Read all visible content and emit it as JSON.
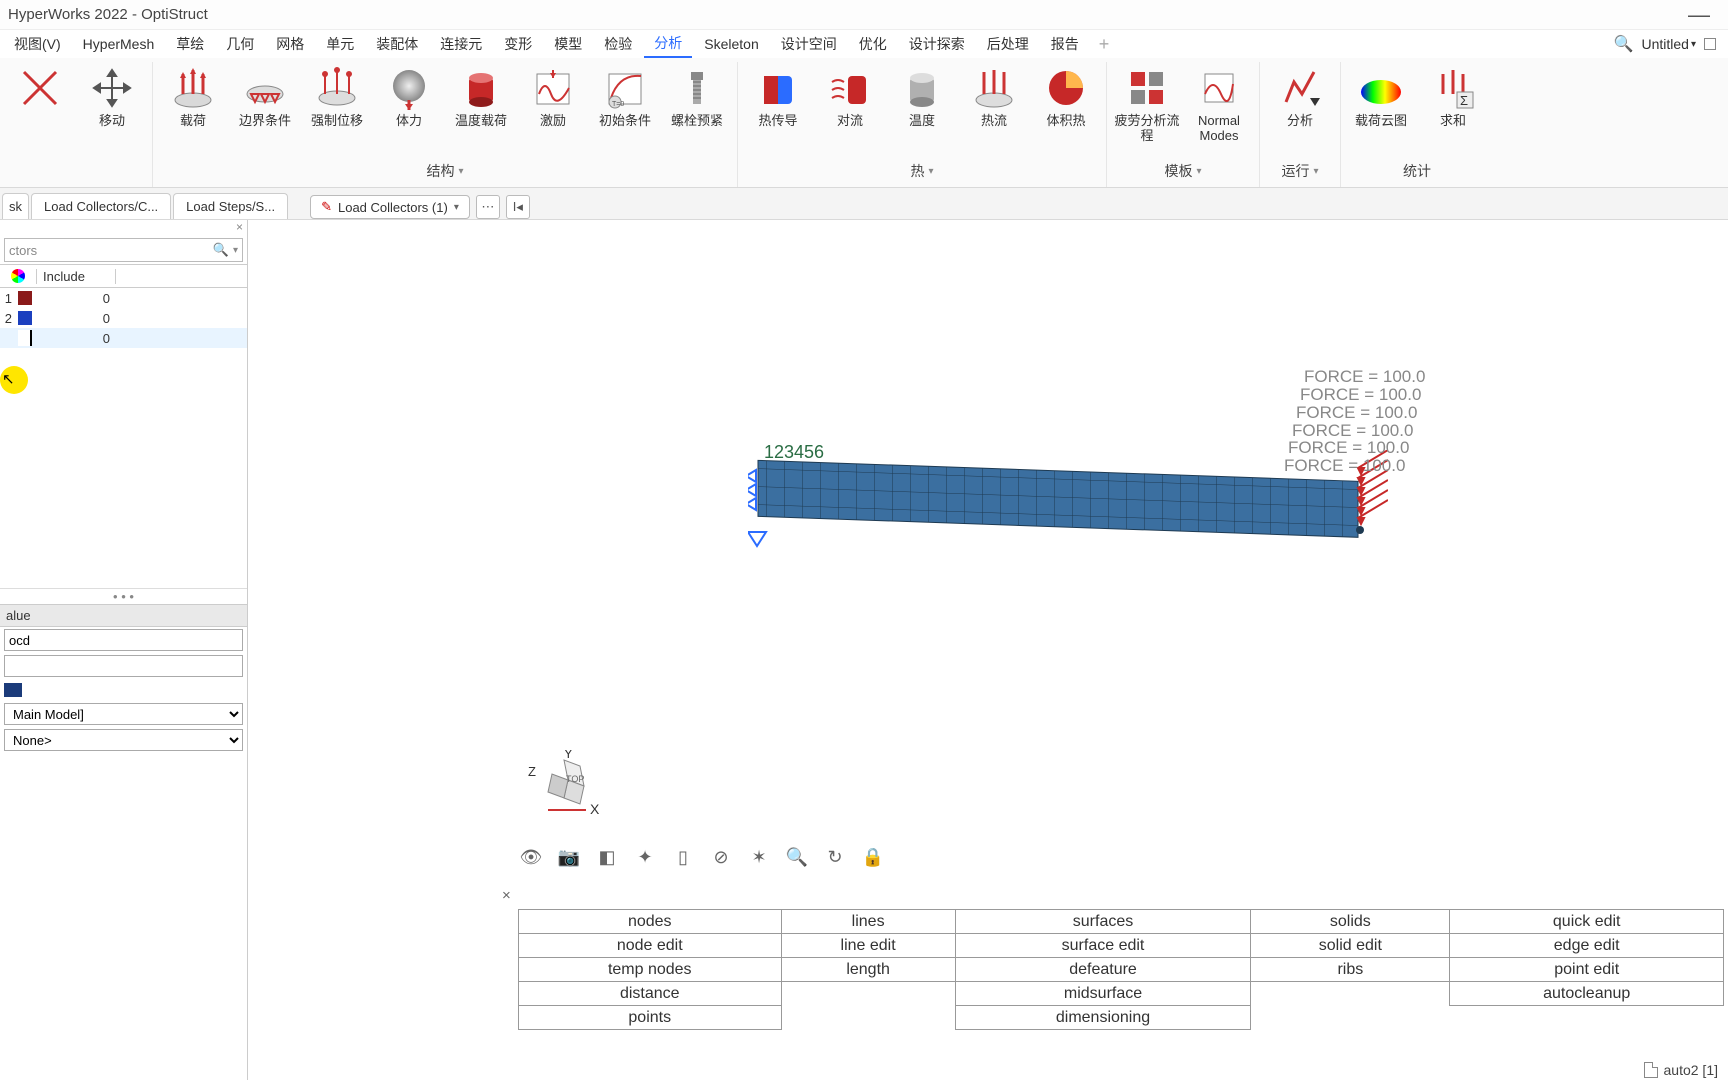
{
  "title": "HyperWorks 2022 - OptiStruct",
  "doc_name": "Untitled",
  "menus": [
    "视图(V)",
    "HyperMesh",
    "草绘",
    "几何",
    "网格",
    "单元",
    "装配体",
    "连接元",
    "变形",
    "模型",
    "检验",
    "分析",
    "Skeleton",
    "设计空间",
    "优化",
    "设计探索",
    "后处理",
    "报告"
  ],
  "active_menu": 11,
  "ribbon": {
    "g_move": {
      "label": "",
      "items": [
        {
          "l": "移动"
        }
      ]
    },
    "g_struct": {
      "label": "结构",
      "items": [
        {
          "l": "载荷"
        },
        {
          "l": "边界条件"
        },
        {
          "l": "强制位移"
        },
        {
          "l": "体力"
        },
        {
          "l": "温度载荷"
        },
        {
          "l": "激励"
        },
        {
          "l": "初始条件"
        },
        {
          "l": "螺栓预紧"
        }
      ]
    },
    "g_heat": {
      "label": "热",
      "items": [
        {
          "l": "热传导"
        },
        {
          "l": "对流"
        },
        {
          "l": "温度"
        },
        {
          "l": "热流"
        },
        {
          "l": "体积热"
        }
      ]
    },
    "g_tpl": {
      "label": "模板",
      "items": [
        {
          "l": "疲劳分析流程"
        },
        {
          "l": "Normal Modes"
        }
      ]
    },
    "g_run": {
      "label": "运行",
      "items": [
        {
          "l": "分析"
        }
      ]
    },
    "g_stat": {
      "label": "统计",
      "items": [
        {
          "l": "载荷云图"
        },
        {
          "l": "求和"
        }
      ]
    }
  },
  "tabs": {
    "t0": "sk",
    "t1": "Load Collectors/C...",
    "t2": "Load Steps/S..."
  },
  "toolcap": "Load Collectors (1)",
  "left": {
    "search_ph": "ctors",
    "include": "Include",
    "rows": [
      {
        "id": "1",
        "color": "#8a1a1a",
        "inc": "0"
      },
      {
        "id": "2",
        "color": "#1b3fbf",
        "inc": "0"
      },
      {
        "id": "",
        "color": "#e8f4ff",
        "inc": "0"
      }
    ],
    "prop_head": "alue",
    "prop_name": "ocd",
    "prop_model": "Main Model]",
    "prop_none": "None>"
  },
  "view": {
    "nodenum": "123456",
    "forces": [
      "FORCE = 100.0",
      "FORCE = 100.0",
      "FORCE = 100.0",
      "FORCE = 100.0",
      "FORCE = 100.0",
      "FORCE = 100.0"
    ],
    "axis_x": "X",
    "axis_y": "Y",
    "axis_z": "Z",
    "axis_top": "TOP"
  },
  "cmd": {
    "r1": [
      "nodes",
      "lines",
      "surfaces",
      "solids",
      "quick edit"
    ],
    "r2": [
      "node edit",
      "line edit",
      "surface edit",
      "solid edit",
      "edge edit"
    ],
    "r3": [
      "temp nodes",
      "length",
      "defeature",
      "ribs",
      "point edit"
    ],
    "r4": [
      "distance",
      "",
      "midsurface",
      "",
      "autocleanup"
    ],
    "r5": [
      "points",
      "",
      "dimensioning",
      "",
      ""
    ]
  },
  "status": "auto2 [1]"
}
